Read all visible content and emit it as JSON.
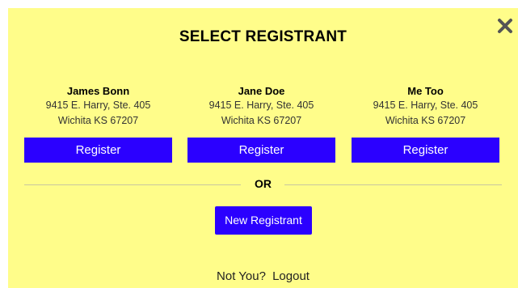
{
  "dialog": {
    "title": "SELECT REGISTRANT",
    "close_icon": "close-icon"
  },
  "registrants": [
    {
      "name": "James Bonn",
      "address_line1": "9415 E. Harry, Ste. 405",
      "address_line2": "Wichita KS 67207",
      "button_label": "Register"
    },
    {
      "name": "Jane Doe",
      "address_line1": "9415 E. Harry, Ste. 405",
      "address_line2": "Wichita KS 67207",
      "button_label": "Register"
    },
    {
      "name": "Me Too",
      "address_line1": "9415 E. Harry, Ste. 405",
      "address_line2": "Wichita KS 67207",
      "button_label": "Register"
    }
  ],
  "separator": {
    "label": "OR"
  },
  "new_registrant": {
    "label": "New Registrant"
  },
  "footer": {
    "prompt": "Not You?",
    "logout_label": "Logout"
  },
  "colors": {
    "background": "#fffd8a",
    "button": "#2b00ff",
    "button_text": "#ffffff"
  }
}
